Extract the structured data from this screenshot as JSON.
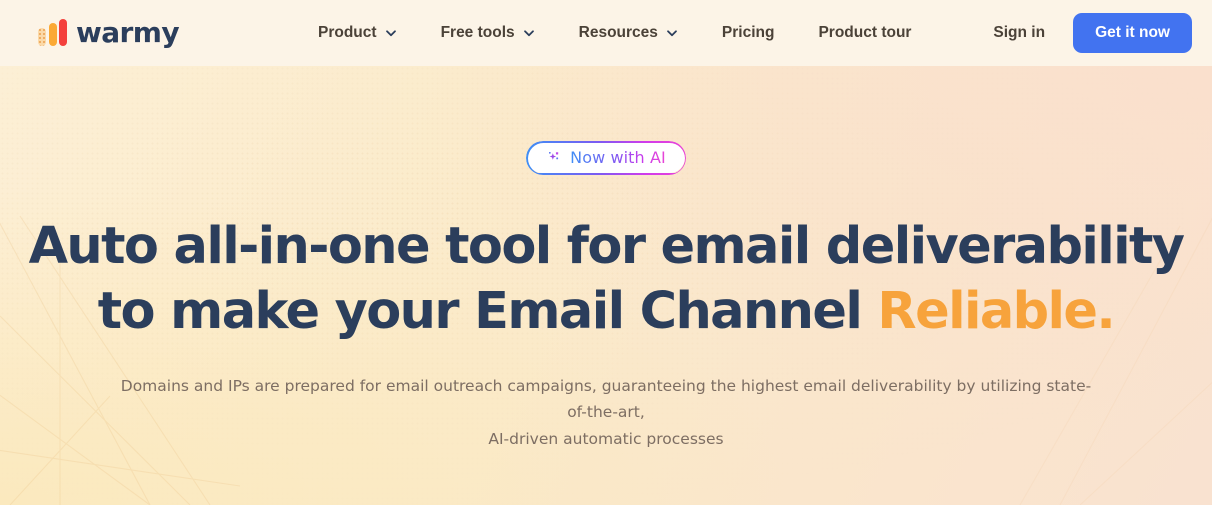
{
  "brand": {
    "name": "warmy",
    "logo_icon": "warmy-bars-logo",
    "colors": {
      "bar1": "#FBD9A8",
      "bar2": "#FBA935",
      "bar3": "#F4403C",
      "wordmark": "#2B3E5C"
    }
  },
  "header": {
    "background": "#FCF4E7",
    "nav": [
      {
        "label": "Product",
        "has_dropdown": true,
        "icon": "chevron-down-icon"
      },
      {
        "label": "Free tools",
        "has_dropdown": true,
        "icon": "chevron-down-icon"
      },
      {
        "label": "Resources",
        "has_dropdown": true,
        "icon": "chevron-down-icon"
      },
      {
        "label": "Pricing",
        "has_dropdown": false
      },
      {
        "label": "Product tour",
        "has_dropdown": false
      }
    ],
    "sign_in_label": "Sign in",
    "cta_label": "Get it now",
    "cta_color": "#4273F0",
    "nav_text_color": "#4B4238"
  },
  "hero": {
    "badge": {
      "icon": "sparkle-icon",
      "label": "Now with AI",
      "gradient_from": "#3F8FF5",
      "gradient_mid": "#7B5BF2",
      "gradient_to": "#E945D6"
    },
    "headline": {
      "line1": "Auto all-in-one tool for email deliverability",
      "line2_prefix": "to make your Email Channel ",
      "line2_accent": "Reliable.",
      "color": "#2B3E5C",
      "accent_color": "#F7A33C"
    },
    "subtitle": {
      "line1": "Domains and IPs are prepared for email outreach campaigns, guaranteeing the highest email deliverability by utilizing state-of-the-art,",
      "line2": "AI-driven automatic processes",
      "color": "#7D6E63"
    },
    "background": {
      "top_left": "#FCEFD5",
      "top_right": "#FAE0CD",
      "bottom_left": "#FBE9BE",
      "bottom_right": "#F9E2D0"
    }
  }
}
